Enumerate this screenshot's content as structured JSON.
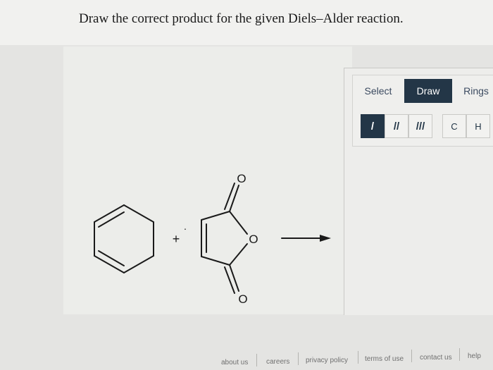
{
  "question": {
    "text": "Draw the correct product for the given Diels–Alder reaction."
  },
  "toolbar": {
    "tabs": [
      {
        "label": "Select",
        "active": false
      },
      {
        "label": "Draw",
        "active": true
      },
      {
        "label": "Rings",
        "active": false
      }
    ],
    "bonds": [
      {
        "label": "/",
        "icon": "single-bond-icon",
        "selected": true
      },
      {
        "label": "//",
        "icon": "double-bond-icon",
        "selected": false
      },
      {
        "label": "///",
        "icon": "triple-bond-icon",
        "selected": false
      }
    ],
    "atoms": [
      "C",
      "H"
    ]
  },
  "reaction": {
    "plus": "+",
    "dot": "·",
    "atoms": {
      "carbonyl_top": "O",
      "ring_oxygen": "O",
      "carbonyl_bottom": "O"
    },
    "arrow_icon": "reaction-arrow-icon"
  },
  "footer": {
    "links": [
      "about us",
      "careers",
      "privacy policy",
      "terms of use",
      "contact us",
      "help"
    ]
  },
  "colors": {
    "accent": "#233647",
    "text": "#1a1a1a",
    "link": "#707070"
  }
}
